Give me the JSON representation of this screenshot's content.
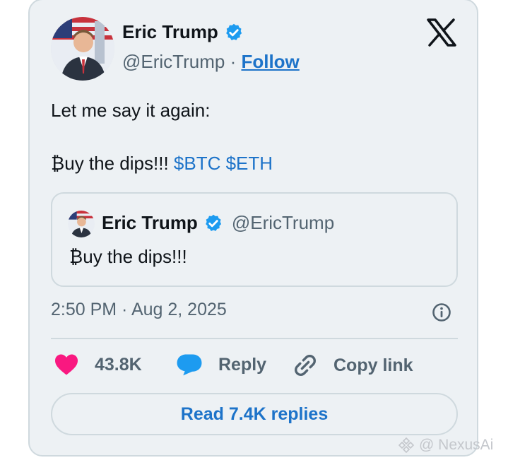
{
  "author": {
    "name": "Eric Trump",
    "handle": "@EricTrump",
    "separator": "·",
    "follow_label": "Follow"
  },
  "tweet": {
    "line1": "Let me say it again:",
    "line2_text": "₿uy the dips!!!",
    "line2_tags": "$BTC $ETH"
  },
  "quoted": {
    "name": "Eric Trump",
    "handle": "@EricTrump",
    "text": "₿uy the dips!!!"
  },
  "timestamp": "2:50 PM · Aug 2, 2025",
  "actions": {
    "likes": "43.8K",
    "reply_label": "Reply",
    "copy_label": "Copy link"
  },
  "read_replies_label": "Read 7.4K replies",
  "watermark": "@ NexusAi",
  "colors": {
    "accent": "#1d73c9",
    "like": "#f91880",
    "reply_icon": "#1d9bf0",
    "card_bg": "#edf1f4",
    "border": "#cfd9de"
  },
  "icons": [
    "x-logo-icon",
    "verified-badge-icon",
    "heart-icon",
    "reply-bubble-icon",
    "link-icon",
    "info-icon"
  ]
}
